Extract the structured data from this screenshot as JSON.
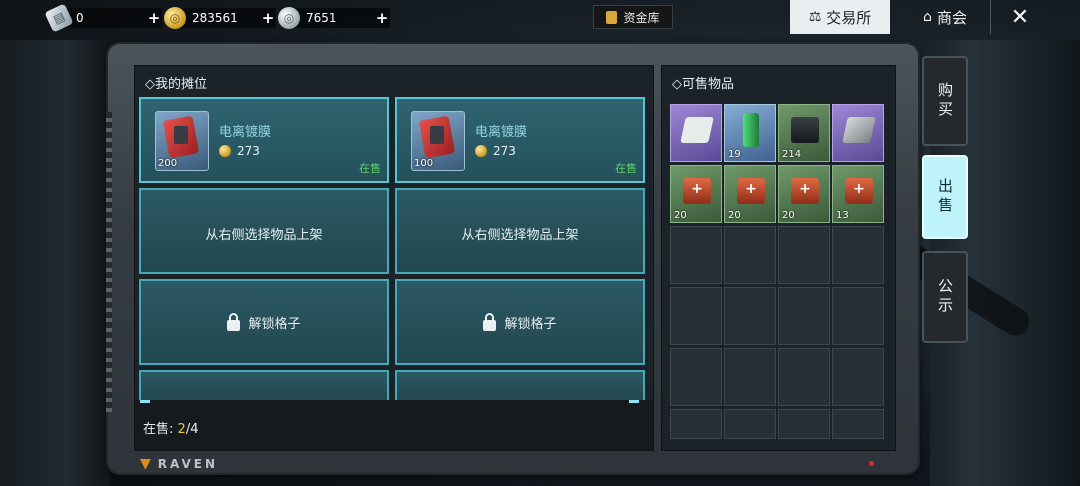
{
  "currencies": [
    {
      "icon": "ticket-icon",
      "value": "0"
    },
    {
      "icon": "gold-coin-icon",
      "value": "283561"
    },
    {
      "icon": "silver-coin-icon",
      "value": "7651"
    }
  ],
  "header": {
    "vault_label": "资金库",
    "exchange_label": "交易所",
    "shop_label": "商会"
  },
  "stall": {
    "title": "我的摊位",
    "filled_slots": [
      {
        "name": "电离镀膜",
        "qty": "200",
        "price": "273",
        "status": "在售"
      },
      {
        "name": "电离镀膜",
        "qty": "100",
        "price": "273",
        "status": "在售"
      }
    ],
    "empty_hint": "从右侧选择物品上架",
    "locked_label": "解锁格子",
    "on_sale_label": "在售:",
    "on_sale_current": "2",
    "on_sale_total": "/4"
  },
  "sellable": {
    "title": "可售物品",
    "items": [
      {
        "icon": "document-icon",
        "rarity": "purple",
        "qty": ""
      },
      {
        "icon": "canister-icon",
        "rarity": "blue",
        "qty": "19"
      },
      {
        "icon": "battery-icon",
        "rarity": "green",
        "qty": "214"
      },
      {
        "icon": "metal-plate-icon",
        "rarity": "purple",
        "qty": ""
      },
      {
        "icon": "medkit-icon",
        "rarity": "green",
        "qty": "20"
      },
      {
        "icon": "medkit-icon",
        "rarity": "green",
        "qty": "20"
      },
      {
        "icon": "medkit-icon",
        "rarity": "green",
        "qty": "20"
      },
      {
        "icon": "medkit-icon",
        "rarity": "green",
        "qty": "13"
      }
    ]
  },
  "side_tabs": [
    {
      "label": "购买",
      "active": false
    },
    {
      "label": "出售",
      "active": true
    },
    {
      "label": "公示",
      "active": false
    }
  ],
  "brand": "RAVEN",
  "colors": {
    "accent": "#57c4d2",
    "status_green": "#5fd06a",
    "gold": "#f0c63c"
  }
}
